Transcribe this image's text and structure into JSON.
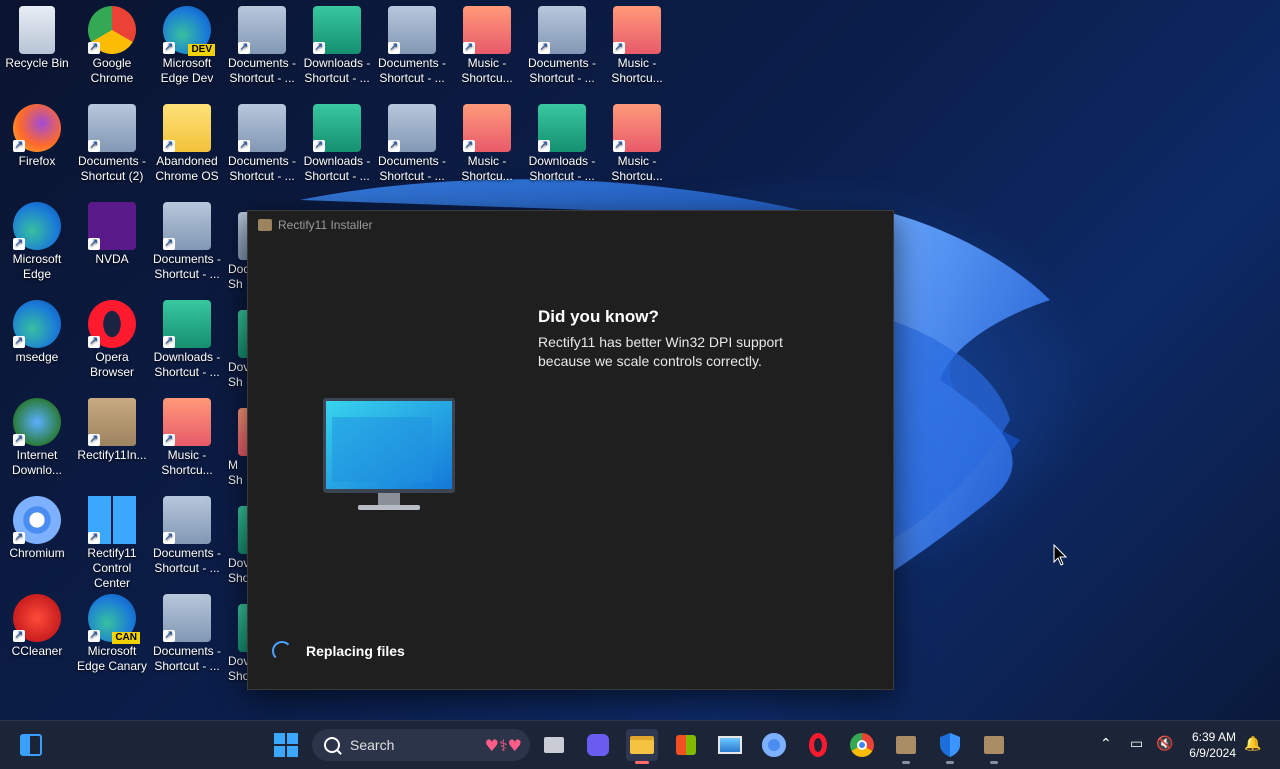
{
  "desktop_icons": [
    {
      "label": "Recycle Bin",
      "icon": "recycle-bin-icon"
    },
    {
      "label": "Google\nChrome",
      "icon": "chrome-icon"
    },
    {
      "label": "Microsoft\nEdge Dev",
      "icon": "edge-dev-icon",
      "badge": "DEV"
    },
    {
      "label": "Documents -\nShortcut - ...",
      "icon": "documents-folder-icon"
    },
    {
      "label": "Downloads -\nShortcut - ...",
      "icon": "downloads-folder-icon"
    },
    {
      "label": "Documents -\nShortcut - ...",
      "icon": "documents-folder-icon"
    },
    {
      "label": "Music -\nShortcu...",
      "icon": "music-folder-icon"
    },
    {
      "label": "Documents -\nShortcut - ...",
      "icon": "documents-folder-icon"
    },
    {
      "label": "Music -\nShortcu...",
      "icon": "music-folder-icon"
    },
    {
      "label": "Firefox",
      "icon": "firefox-icon"
    },
    {
      "label": "Documents -\nShortcut (2)",
      "icon": "documents-folder-icon"
    },
    {
      "label": "Abandoned\nChrome OS",
      "icon": "yellow-folder-icon"
    },
    {
      "label": "Documents -\nShortcut - ...",
      "icon": "documents-folder-icon"
    },
    {
      "label": "Downloads -\nShortcut - ...",
      "icon": "downloads-folder-icon"
    },
    {
      "label": "Documents -\nShortcut - ...",
      "icon": "documents-folder-icon"
    },
    {
      "label": "Music -\nShortcu...",
      "icon": "music-folder-icon"
    },
    {
      "label": "Downloads -\nShortcut - ...",
      "icon": "downloads-folder-icon"
    },
    {
      "label": "Music -\nShortcu...",
      "icon": "music-folder-icon"
    },
    {
      "label": "Microsoft\nEdge",
      "icon": "edge-icon"
    },
    {
      "label": "NVDA",
      "icon": "nvda-icon"
    },
    {
      "label": "Documents -\nShortcut - ...",
      "icon": "documents-folder-icon"
    },
    {
      "label": "msedge",
      "icon": "edge-icon"
    },
    {
      "label": "Opera\nBrowser",
      "icon": "opera-icon"
    },
    {
      "label": "Downloads -\nShortcut - ...",
      "icon": "downloads-folder-icon"
    },
    {
      "label": "Internet\nDownlo...",
      "icon": "internet-download-manager-icon"
    },
    {
      "label": "Rectify11In...",
      "icon": "installer-box-icon"
    },
    {
      "label": "Music -\nShortcu...",
      "icon": "music-folder-icon"
    },
    {
      "label": "Chromium",
      "icon": "chromium-icon"
    },
    {
      "label": "Rectify11\nControl\nCenter",
      "icon": "windows-logo-icon"
    },
    {
      "label": "Documents -\nShortcut - ...",
      "icon": "documents-folder-icon"
    },
    {
      "label": "CCleaner",
      "icon": "ccleaner-icon"
    },
    {
      "label": "Microsoft\nEdge Canary",
      "icon": "edge-canary-icon",
      "badge": "CAN"
    },
    {
      "label": "Documents -\nShortcut - ...",
      "icon": "documents-folder-icon"
    }
  ],
  "partial_icons": [
    "Doc\nSh",
    "Dov\nSh",
    "M\nSh",
    "Dov\nSho",
    "Dov\nSho"
  ],
  "installer": {
    "title": "Rectify11 Installer",
    "tip_title": "Did you know?",
    "tip_text": "Rectify11 has better Win32 DPI support because we scale controls correctly.",
    "status": "Replacing files"
  },
  "taskbar": {
    "search_placeholder": "Search",
    "time": "6:39 AM",
    "date": "6/9/2024",
    "apps": [
      "widgets-icon",
      "start-icon",
      "task-view-icon",
      "meet-icon",
      "file-explorer-icon",
      "store-icon",
      "photos-icon",
      "chromium-icon",
      "opera-icon",
      "chrome-icon",
      "installer-box-icon",
      "defender-icon",
      "installer-box-icon"
    ]
  },
  "colors": {
    "accent": "#4aa3ff",
    "window_bg": "#1f1f1f",
    "taskbar_bg": "#1c2538"
  }
}
